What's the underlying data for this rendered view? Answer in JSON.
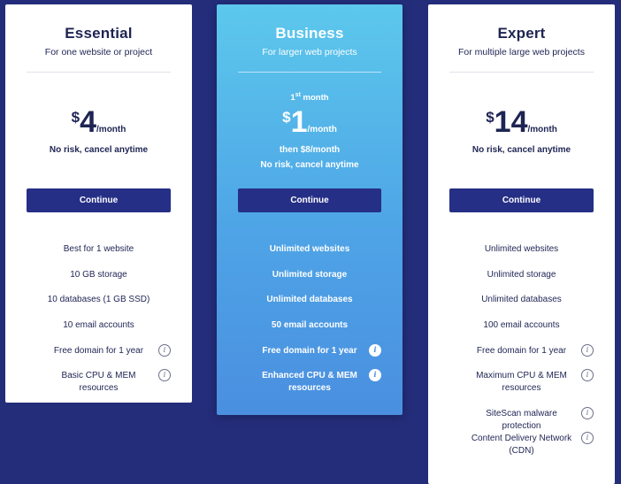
{
  "plans": {
    "essential": {
      "name": "Essential",
      "subtitle": "For one website or project",
      "currency": "$",
      "price": "4",
      "per": "/month",
      "note": "No risk, cancel anytime",
      "cta": "Continue",
      "features": [
        {
          "text": "Best for 1 website",
          "info": false
        },
        {
          "text": "10 GB storage",
          "info": false
        },
        {
          "text": "10 databases (1 GB SSD)",
          "info": false
        },
        {
          "text": "10 email accounts",
          "info": false
        },
        {
          "text": "Free domain for 1 year",
          "info": true
        },
        {
          "text": "Basic CPU & MEM resources",
          "info": true
        }
      ]
    },
    "business": {
      "name": "Business",
      "subtitle": "For larger web projects",
      "first_month": "1",
      "first_month_sup": "st",
      "first_month_suffix": " month",
      "currency": "$",
      "price": "1",
      "per": "/month",
      "then": "then $8/month",
      "note": "No risk, cancel anytime",
      "cta": "Continue",
      "features": [
        {
          "text": "Unlimited websites",
          "info": false
        },
        {
          "text": "Unlimited storage",
          "info": false
        },
        {
          "text": "Unlimited databases",
          "info": false
        },
        {
          "text": "50 email accounts",
          "info": false
        },
        {
          "text": "Free domain for 1 year",
          "info": true
        },
        {
          "text": "Enhanced CPU & MEM resources",
          "info": true
        }
      ]
    },
    "expert": {
      "name": "Expert",
      "subtitle": "For multiple large web projects",
      "currency": "$",
      "price": "14",
      "per": "/month",
      "note": "No risk, cancel anytime",
      "cta": "Continue",
      "features": [
        {
          "text": "Unlimited websites",
          "info": false
        },
        {
          "text": "Unlimited storage",
          "info": false
        },
        {
          "text": "Unlimited databases",
          "info": false
        },
        {
          "text": "100 email accounts",
          "info": false
        },
        {
          "text": "Free domain for 1 year",
          "info": true
        },
        {
          "text": "Maximum CPU & MEM resources",
          "info": true
        },
        {
          "text": "SiteScan malware protection",
          "info": true
        },
        {
          "text": "Content Delivery Network (CDN)",
          "info": true
        }
      ]
    }
  },
  "info_icon_glyph": "i",
  "colors": {
    "background": "#232d7a",
    "button": "#262f86",
    "highlight_gradient_top": "#5cc8ec",
    "highlight_gradient_bottom": "#4a8fe0"
  }
}
